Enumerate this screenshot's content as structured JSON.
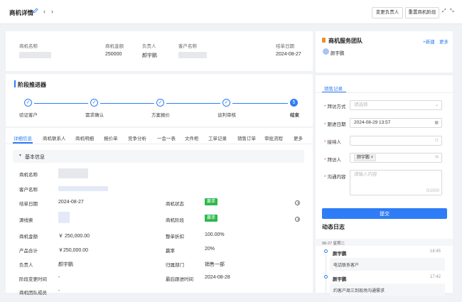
{
  "header": {
    "title": "商机详情",
    "btn_change_owner": "变更负责人",
    "btn_reset_stage": "重置商机阶段"
  },
  "summary": {
    "col_name": "商机名称",
    "col_amount": "商机金额",
    "col_owner": "负责人",
    "col_customer": "客户名称",
    "col_close_date": "结单日期",
    "amount": "250000",
    "owner": "颜宇鹏",
    "close_date": "2024-08-27"
  },
  "team": {
    "title": "商机服务团队",
    "new": "+新建",
    "more": "更多",
    "member": "颜宇鹏"
  },
  "stages": {
    "title": "阶段推进器",
    "items": [
      "验证客户",
      "需求确认",
      "方案报价",
      "谈判审核",
      "结束"
    ],
    "current_num": "5"
  },
  "tabs": [
    "详细信息",
    "商机联系人",
    "商机明细",
    "报价单",
    "竞争分析",
    "一会一表",
    "文件柜",
    "工单记录",
    "销售订单",
    "审批流程",
    "更多"
  ],
  "detail": {
    "section": "基本信息",
    "l_name": "商机名称",
    "l_customer": "客户名称",
    "l_close_date": "结单日期",
    "v_close_date": "2024-08-27",
    "l_source": "源线索",
    "l_amount": "商机金额",
    "v_amount": "￥ 250,000.00",
    "l_product_total": "产品合计",
    "v_product_total": "￥250,000.00",
    "l_owner": "负责人",
    "v_owner": "颜宇鹏",
    "l_stage_change": "阶段变更时间",
    "v_stage_change": "-",
    "l_team": "商机团队成员",
    "v_team": "-",
    "l_status": "商机状态",
    "v_status": "赢单",
    "l_stage": "商机阶段",
    "v_stage": "赢单",
    "l_discount": "整单折扣",
    "v_discount": "100.00%",
    "l_win_rate": "赢率",
    "v_win_rate": "20%",
    "l_dept": "归属部门",
    "v_dept": "销售一部",
    "l_last_follow": "最后跟进时间",
    "v_last_follow": "2024-08-28"
  },
  "sales": {
    "tab": "销售记录",
    "l_visit_method": "拜访方式",
    "ph_visit_method": "请选择",
    "l_follow_date": "跟进日期",
    "v_follow_date": "2024-08-29 13:57",
    "l_receiver": "接待人",
    "l_visitor": "拜访人",
    "v_visitor": "颜宇鹏",
    "l_content": "沟通内容",
    "ph_content": "请输入内容",
    "counter": "0/1000",
    "submit": "提交"
  },
  "log": {
    "title": "动态日志",
    "date": "08-27 星期二",
    "items": [
      {
        "user": "颜宇鹏",
        "time": "18:45",
        "text": "电话联系客户"
      },
      {
        "user": "颜宇鹏",
        "time": "17:42",
        "text": "约客户周三到现场沟通需求"
      }
    ]
  },
  "colors": {
    "accent": "#2e7cf6",
    "success": "#2db84d",
    "required": "#e34d4d"
  }
}
